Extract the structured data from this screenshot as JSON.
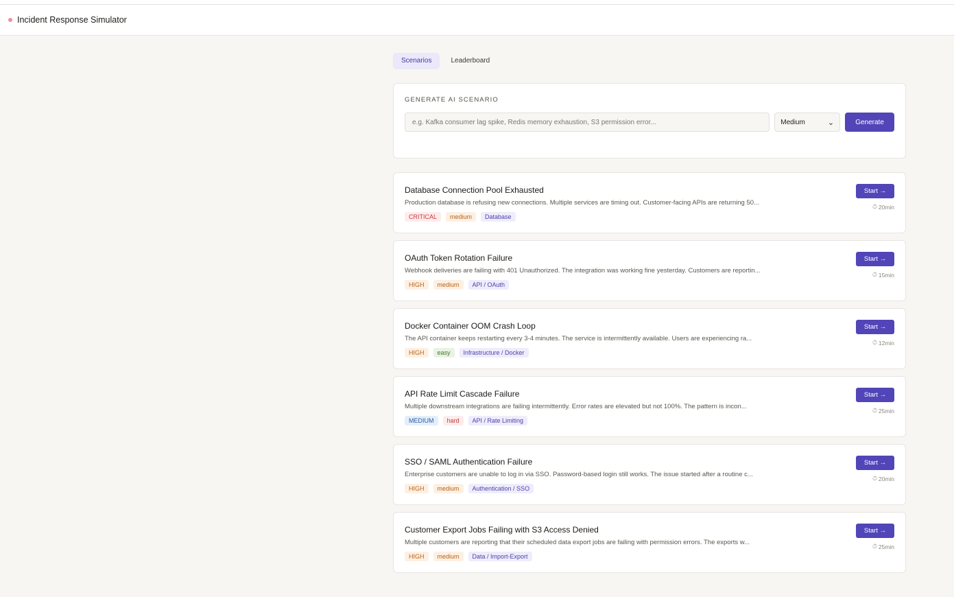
{
  "app": {
    "title": "Incident Response Simulator",
    "status_dot_color": "#f08f9f"
  },
  "tabs": [
    {
      "label": "Scenarios",
      "active": true
    },
    {
      "label": "Leaderboard",
      "active": false
    }
  ],
  "generator": {
    "title": "GENERATE AI SCENARIO",
    "placeholder": "e.g. Kafka consumer lag spike, Redis memory exhaustion, S3 permission error...",
    "difficulty": "Medium",
    "button": "Generate"
  },
  "start_label": "Start →",
  "clock_icon": "clock-icon",
  "accent_color": "#5145b8",
  "scenarios": [
    {
      "title": "Database Connection Pool Exhausted",
      "description": "Production database is refusing new connections. Multiple services are timing out. Customer-facing APIs are returning 50...",
      "severity": "CRITICAL",
      "difficulty": "medium",
      "category": "Database",
      "duration": "20min"
    },
    {
      "title": "OAuth Token Rotation Failure",
      "description": "Webhook deliveries are failing with 401 Unauthorized. The integration was working fine yesterday. Customers are reportin...",
      "severity": "HIGH",
      "difficulty": "medium",
      "category": "API / OAuth",
      "duration": "15min"
    },
    {
      "title": "Docker Container OOM Crash Loop",
      "description": "The API container keeps restarting every 3-4 minutes. The service is intermittently available. Users are experiencing ra...",
      "severity": "HIGH",
      "difficulty": "easy",
      "category": "Infrastructure / Docker",
      "duration": "12min"
    },
    {
      "title": "API Rate Limit Cascade Failure",
      "description": "Multiple downstream integrations are failing intermittently. Error rates are elevated but not 100%. The pattern is incon...",
      "severity": "MEDIUM",
      "difficulty": "hard",
      "category": "API / Rate Limiting",
      "duration": "25min"
    },
    {
      "title": "SSO / SAML Authentication Failure",
      "description": "Enterprise customers are unable to log in via SSO. Password-based login still works. The issue started after a routine c...",
      "severity": "HIGH",
      "difficulty": "medium",
      "category": "Authentication / SSO",
      "duration": "20min"
    },
    {
      "title": "Customer Export Jobs Failing with S3 Access Denied",
      "description": "Multiple customers are reporting that their scheduled data export jobs are failing with permission errors. The exports w...",
      "severity": "HIGH",
      "difficulty": "medium",
      "category": "Data / Import-Export",
      "duration": "25min"
    }
  ]
}
